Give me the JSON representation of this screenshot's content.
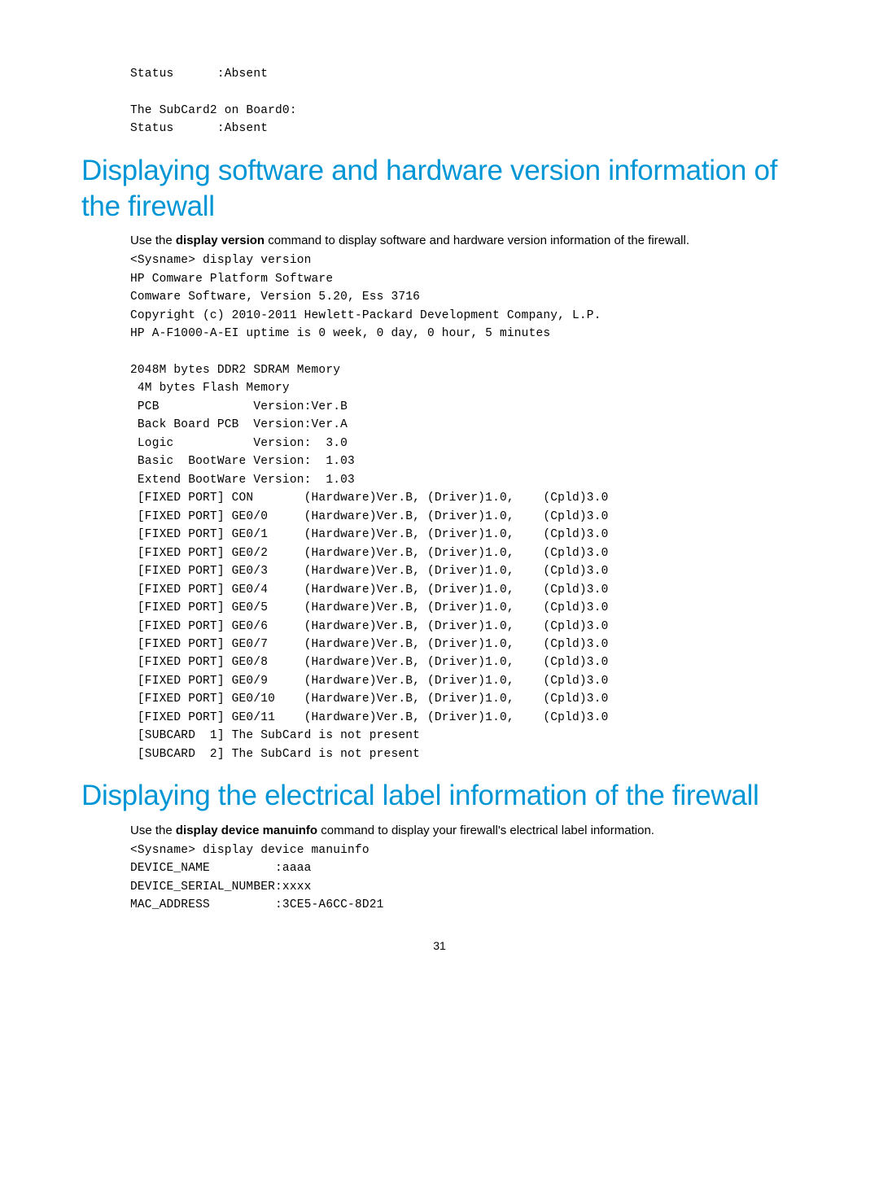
{
  "pre_block": "Status      :Absent\n\nThe SubCard2 on Board0:\nStatus      :Absent",
  "heading1": "Displaying software and hardware version information of the firewall",
  "intro1_pre": "Use the ",
  "intro1_cmd": "display version",
  "intro1_post": " command to display software and hardware version information of the firewall.",
  "code1": "<Sysname> display version\nHP Comware Platform Software\nComware Software, Version 5.20, Ess 3716\nCopyright (c) 2010-2011 Hewlett-Packard Development Company, L.P.\nHP A-F1000-A-EI uptime is 0 week, 0 day, 0 hour, 5 minutes\n\n2048M bytes DDR2 SDRAM Memory\n 4M bytes Flash Memory\n PCB             Version:Ver.B\n Back Board PCB  Version:Ver.A\n Logic           Version:  3.0\n Basic  BootWare Version:  1.03\n Extend BootWare Version:  1.03\n [FIXED PORT] CON       (Hardware)Ver.B, (Driver)1.0,    (Cpld)3.0\n [FIXED PORT] GE0/0     (Hardware)Ver.B, (Driver)1.0,    (Cpld)3.0\n [FIXED PORT] GE0/1     (Hardware)Ver.B, (Driver)1.0,    (Cpld)3.0\n [FIXED PORT] GE0/2     (Hardware)Ver.B, (Driver)1.0,    (Cpld)3.0\n [FIXED PORT] GE0/3     (Hardware)Ver.B, (Driver)1.0,    (Cpld)3.0\n [FIXED PORT] GE0/4     (Hardware)Ver.B, (Driver)1.0,    (Cpld)3.0\n [FIXED PORT] GE0/5     (Hardware)Ver.B, (Driver)1.0,    (Cpld)3.0\n [FIXED PORT] GE0/6     (Hardware)Ver.B, (Driver)1.0,    (Cpld)3.0\n [FIXED PORT] GE0/7     (Hardware)Ver.B, (Driver)1.0,    (Cpld)3.0\n [FIXED PORT] GE0/8     (Hardware)Ver.B, (Driver)1.0,    (Cpld)3.0\n [FIXED PORT] GE0/9     (Hardware)Ver.B, (Driver)1.0,    (Cpld)3.0\n [FIXED PORT] GE0/10    (Hardware)Ver.B, (Driver)1.0,    (Cpld)3.0\n [FIXED PORT] GE0/11    (Hardware)Ver.B, (Driver)1.0,    (Cpld)3.0\n [SUBCARD  1] The SubCard is not present\n [SUBCARD  2] The SubCard is not present",
  "heading2": "Displaying the electrical label information of the firewall",
  "intro2_pre": "Use the ",
  "intro2_cmd": "display device manuinfo",
  "intro2_post": " command to display your firewall's electrical label information.",
  "code2": "<Sysname> display device manuinfo\nDEVICE_NAME         :aaaa\nDEVICE_SERIAL_NUMBER:xxxx\nMAC_ADDRESS         :3CE5-A6CC-8D21",
  "page_number": "31"
}
